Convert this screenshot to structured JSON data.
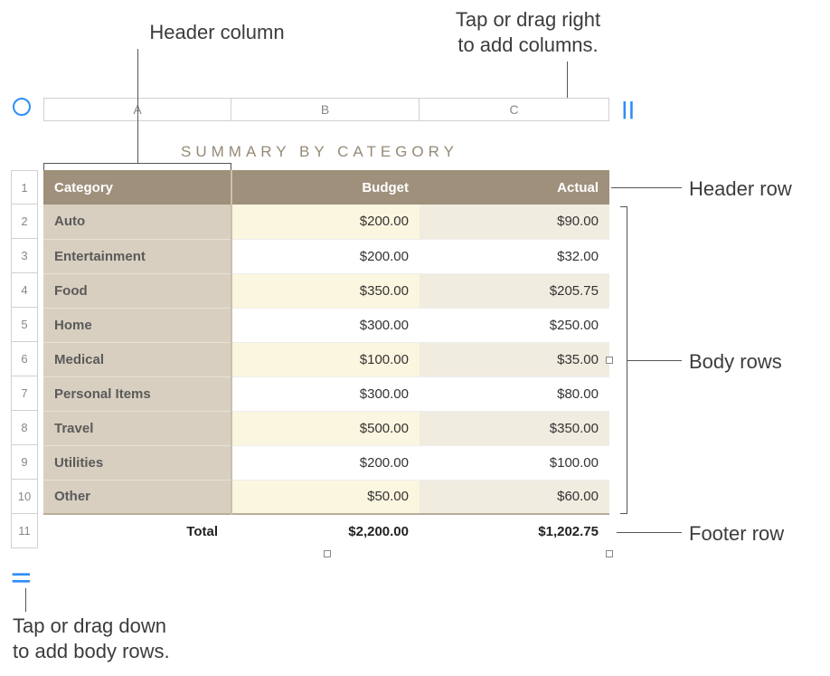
{
  "callouts": {
    "header_column": "Header column",
    "add_columns_l1": "Tap or drag right",
    "add_columns_l2": "to add columns.",
    "header_row": "Header row",
    "body_rows": "Body rows",
    "footer_row": "Footer row",
    "add_rows_l1": "Tap or drag down",
    "add_rows_l2": "to add body rows."
  },
  "table": {
    "title": "SUMMARY BY CATEGORY",
    "column_letters": [
      "A",
      "B",
      "C"
    ],
    "row_numbers": [
      "1",
      "2",
      "3",
      "4",
      "5",
      "6",
      "7",
      "8",
      "9",
      "10",
      "11"
    ],
    "headers": {
      "category": "Category",
      "budget": "Budget",
      "actual": "Actual"
    },
    "rows": [
      {
        "category": "Auto",
        "budget": "$200.00",
        "actual": "$90.00"
      },
      {
        "category": "Entertainment",
        "budget": "$200.00",
        "actual": "$32.00"
      },
      {
        "category": "Food",
        "budget": "$350.00",
        "actual": "$205.75"
      },
      {
        "category": "Home",
        "budget": "$300.00",
        "actual": "$250.00"
      },
      {
        "category": "Medical",
        "budget": "$100.00",
        "actual": "$35.00"
      },
      {
        "category": "Personal Items",
        "budget": "$300.00",
        "actual": "$80.00"
      },
      {
        "category": "Travel",
        "budget": "$500.00",
        "actual": "$350.00"
      },
      {
        "category": "Utilities",
        "budget": "$200.00",
        "actual": "$100.00"
      },
      {
        "category": "Other",
        "budget": "$50.00",
        "actual": "$60.00"
      }
    ],
    "footer": {
      "label": "Total",
      "budget": "$2,200.00",
      "actual": "$1,202.75"
    }
  },
  "colors": {
    "header_bg": "#9e907a",
    "header_col_bg": "#d8cfc0",
    "accent": "#2e8ef7"
  }
}
